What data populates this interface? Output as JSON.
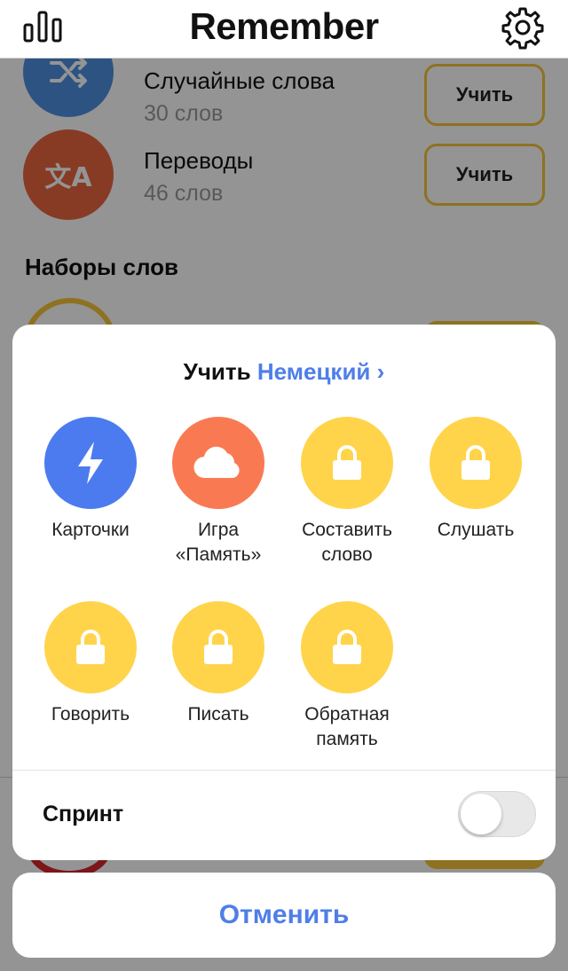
{
  "header": {
    "title": "Remember",
    "left_icon": "stats-icon",
    "right_icon": "gear-icon"
  },
  "background_list": {
    "items": [
      {
        "title": "Случайные слова",
        "subtitle": "30 слов",
        "button": "Учить",
        "icon": "shuffle-icon",
        "color": "#4f8fe0"
      },
      {
        "title": "Переводы",
        "subtitle": "46 слов",
        "button": "Учить",
        "icon": "translate-icon",
        "color": "#e8673f"
      }
    ],
    "section_title": "Наборы слов"
  },
  "sheet": {
    "title_prefix": "Учить",
    "language": "Немецкий",
    "chevron": "›",
    "modes": [
      {
        "label_1": "Карточки",
        "label_2": "",
        "icon": "lightning-icon",
        "color": "#4b7bef",
        "locked": false
      },
      {
        "label_1": "Игра",
        "label_2": "«Память»",
        "icon": "cloud-icon",
        "color": "#f97a52",
        "locked": false
      },
      {
        "label_1": "Составить",
        "label_2": "слово",
        "icon": "lock-icon",
        "color": "#ffd44a",
        "locked": true
      },
      {
        "label_1": "Слушать",
        "label_2": "",
        "icon": "lock-icon",
        "color": "#ffd44a",
        "locked": true
      },
      {
        "label_1": "Говорить",
        "label_2": "",
        "icon": "lock-icon",
        "color": "#ffd44a",
        "locked": true
      },
      {
        "label_1": "Писать",
        "label_2": "",
        "icon": "lock-icon",
        "color": "#ffd44a",
        "locked": true
      },
      {
        "label_1": "Обратная",
        "label_2": "память",
        "icon": "lock-icon",
        "color": "#ffd44a",
        "locked": true
      }
    ],
    "sprint_label": "Спринт",
    "sprint_enabled": false
  },
  "cancel_label": "Отменить",
  "colors": {
    "accent_blue": "#4e7ee8",
    "button_border": "#f4c43a",
    "locked_yellow": "#ffd44a"
  }
}
